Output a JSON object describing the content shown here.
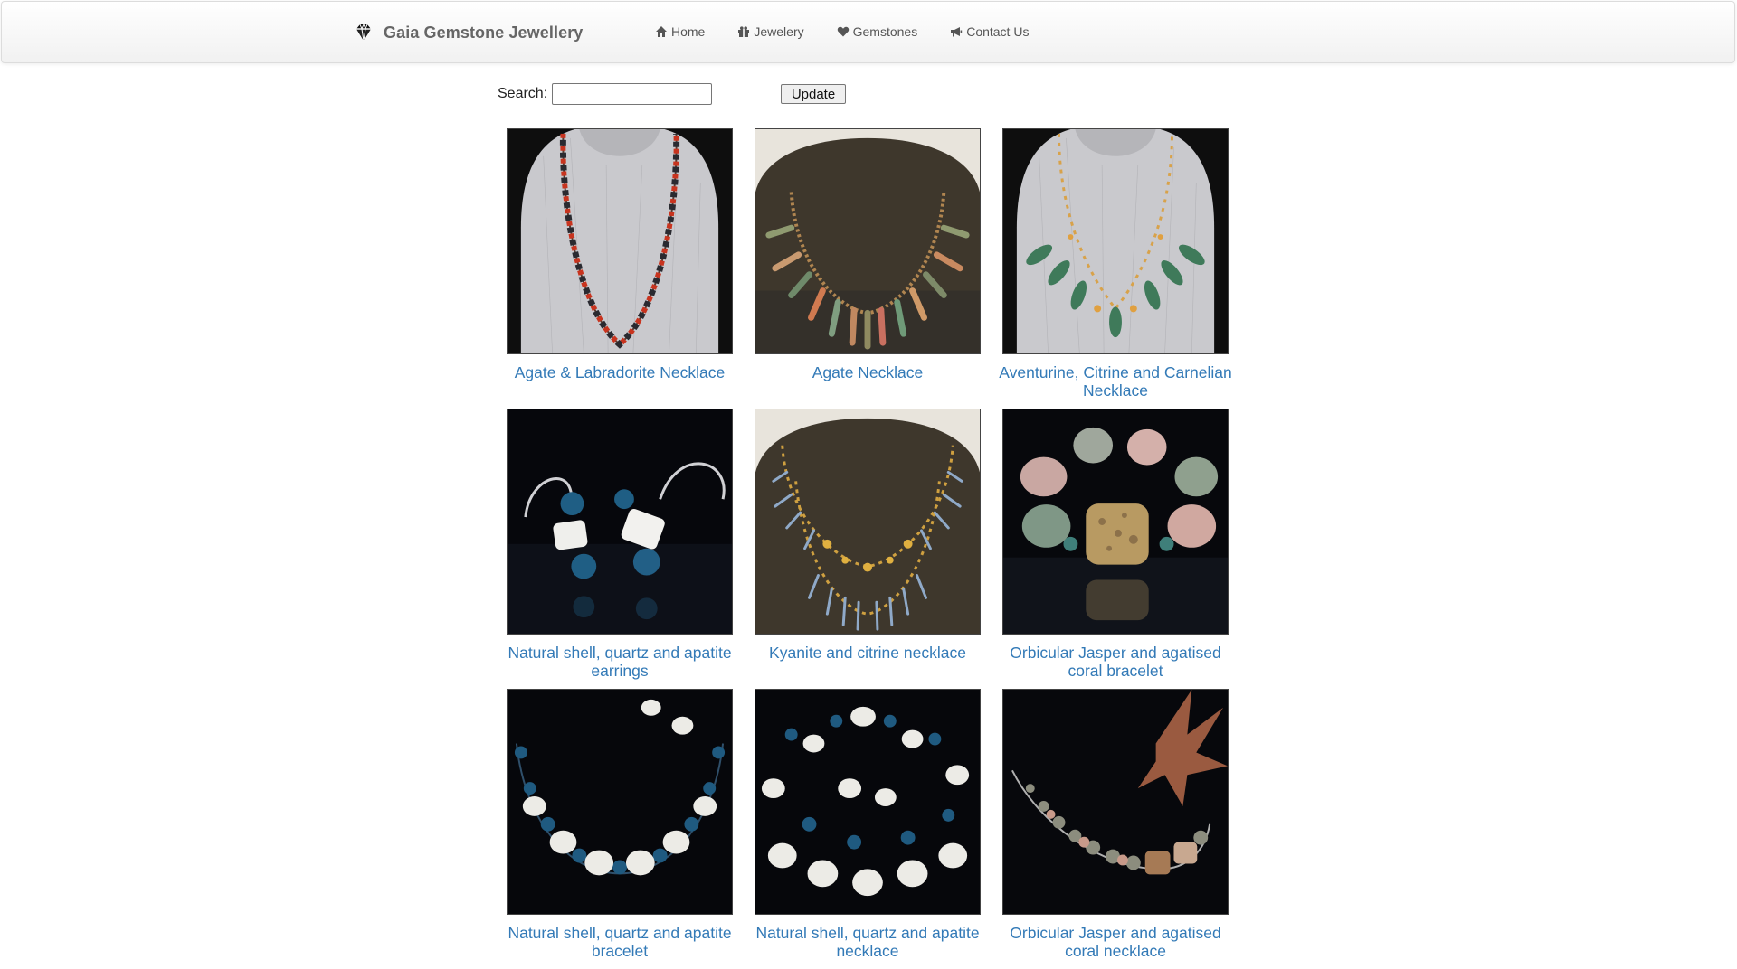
{
  "navbar": {
    "brand": "Gaia Gemstone Jewellery",
    "brand_icon": "diamond-icon",
    "links": [
      {
        "label": "Home",
        "icon": "home-icon"
      },
      {
        "label": "Jewelery",
        "icon": "gift-icon"
      },
      {
        "label": "Gemstones",
        "icon": "heart-icon"
      },
      {
        "label": "Contact Us",
        "icon": "bullhorn-icon"
      }
    ]
  },
  "search": {
    "label": "Search:",
    "value": "",
    "button": "Update"
  },
  "colors": {
    "link": "#337ab7",
    "brand_text": "#666666"
  },
  "products": [
    {
      "title": "Agate & Labradorite Necklace"
    },
    {
      "title": "Agate Necklace"
    },
    {
      "title": "Aventurine, Citrine and Carnelian Necklace"
    },
    {
      "title": "Natural shell, quartz and apatite earrings"
    },
    {
      "title": "Kyanite and citrine necklace"
    },
    {
      "title": "Orbicular Jasper and agatised coral bracelet"
    },
    {
      "title": "Natural shell, quartz and apatite bracelet"
    },
    {
      "title": "Natural shell, quartz and apatite necklace"
    },
    {
      "title": "Orbicular Jasper and agatised coral necklace"
    }
  ]
}
